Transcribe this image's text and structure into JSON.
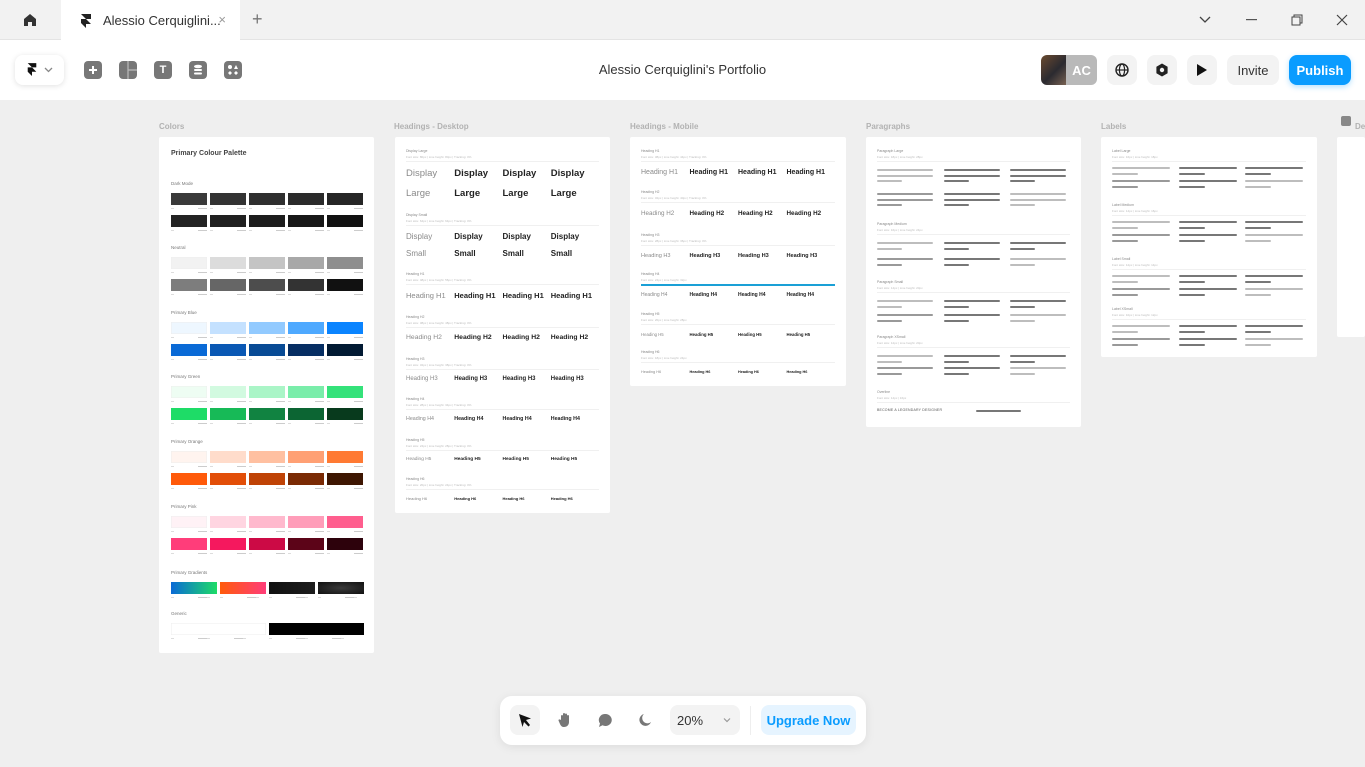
{
  "tabbar": {
    "tab_title": "Alessio Cerquiglini...",
    "close_glyph": "×",
    "new_tab_glyph": "+"
  },
  "toolbar": {
    "document_title": "Alessio Cerquiglini's Portfolio",
    "tools": [
      "insert-icon",
      "layout-icon",
      "text-icon",
      "cms-icon",
      "components-icon"
    ],
    "text_tool_glyph": "T",
    "avatar_initials": "AC",
    "invite_label": "Invite",
    "publish_label": "Publish"
  },
  "canvas": {
    "frames": [
      {
        "label": "Colors"
      },
      {
        "label": "Headings - Desktop"
      },
      {
        "label": "Headings - Mobile"
      },
      {
        "label": "Paragraphs"
      },
      {
        "label": "Labels"
      },
      {
        "label": "De"
      }
    ],
    "colors": {
      "title": "Primary Colour Palette",
      "groups": [
        {
          "name": "Dark Mode",
          "rows": [
            [
              "#3a3a3a",
              "#333333",
              "#2f2f2f",
              "#2b2b2b",
              "#262626"
            ],
            [
              "#232323",
              "#202020",
              "#1d1d1d",
              "#181818",
              "#111111"
            ]
          ]
        },
        {
          "name": "Neutral",
          "rows": [
            [
              "#f2f2f2",
              "#dcdcdc",
              "#c4c4c4",
              "#a8a8a8",
              "#8e8e8e"
            ],
            [
              "#7d7d7d",
              "#666666",
              "#4d4d4d",
              "#333333",
              "#111111"
            ]
          ]
        },
        {
          "name": "Primary Blue",
          "rows": [
            [
              "#eef7ff",
              "#c4e1ff",
              "#92caff",
              "#4ea9ff",
              "#0a84ff"
            ],
            [
              "#0a6ad6",
              "#0a58b4",
              "#084b95",
              "#062e63",
              "#021a33"
            ]
          ]
        },
        {
          "name": "Primary Green",
          "rows": [
            [
              "#eefdf3",
              "#d2fae0",
              "#aaf5c7",
              "#7aedaa",
              "#34e27a"
            ],
            [
              "#1edc67",
              "#17ba57",
              "#118341",
              "#0c6533",
              "#083a1d"
            ]
          ]
        },
        {
          "name": "Primary Orange",
          "rows": [
            [
              "#fff4ef",
              "#ffdccb",
              "#ffc0a1",
              "#ffa074",
              "#ff7a33"
            ],
            [
              "#ff5a0a",
              "#e24e08",
              "#bf4306",
              "#7a2a04",
              "#3e1602"
            ]
          ]
        },
        {
          "name": "Primary Pink",
          "rows": [
            [
              "#fff2f6",
              "#ffd5e1",
              "#ffb9cd",
              "#ff9db9",
              "#ff5e8e"
            ],
            [
              "#ff3d7a",
              "#f5185e",
              "#cc0a45",
              "#5c0418",
              "#2d020c"
            ]
          ]
        },
        {
          "name": "Primary Gradients",
          "gradients": [
            "linear-gradient(90deg,#0a6ad6,#1edc67)",
            "linear-gradient(90deg,#ff5a0a,#ff3d7a)",
            "linear-gradient(90deg,#111111,#1d1d1d)",
            "radial-gradient(#3a3a3a,#111111)"
          ]
        },
        {
          "name": "Generic",
          "rows": [
            [
              "#ffffff",
              "#000000"
            ]
          ]
        }
      ]
    },
    "headings_desktop": {
      "sections": [
        {
          "name": "Display Large",
          "spec": "Font size: 80px | Line height: 80px | Tracking: 0%",
          "lines": [
            "Display",
            "Large"
          ]
        },
        {
          "name": "Display Small",
          "spec": "Font size: 64px | Line height: 64px | Tracking: 0%",
          "lines": [
            "Display",
            "Small"
          ]
        },
        {
          "name": "Heading H1",
          "spec": "Font size: 48px | Line height: 56px | Tracking: 0%",
          "lines": [
            "Heading H1"
          ]
        },
        {
          "name": "Heading H2",
          "spec": "Font size: 38px | Line height: 48px | Tracking: 0%",
          "lines": [
            "Heading H2"
          ]
        },
        {
          "name": "Heading H3",
          "spec": "Font size: 32px | Line height: 38px | Tracking: 0%",
          "lines": [
            "Heading H3"
          ]
        },
        {
          "name": "Heading H4",
          "spec": "Font size: 28px | Line height: 34px | Tracking: 0%",
          "lines": [
            "Heading H4"
          ]
        },
        {
          "name": "Heading H5",
          "spec": "Font size: 24px | Line height: 28px | Tracking: 0%",
          "lines": [
            "Heading H5"
          ]
        },
        {
          "name": "Heading H6",
          "spec": "Font size: 20px | Line height: 24px | Tracking: 0%",
          "lines": [
            "Heading H6"
          ]
        }
      ]
    },
    "headings_mobile": {
      "sections": [
        {
          "name": "Heading H1",
          "spec": "Font size: 38px | Line height: 44px | Tracking: 0%",
          "text": "Heading H1"
        },
        {
          "name": "Heading H2",
          "spec": "Font size: 32px | Line height: 40px | Tracking: 0%",
          "text": "Heading H2"
        },
        {
          "name": "Heading H3",
          "spec": "Font size: 28px | Line height: 36px | Tracking: 0%",
          "text": "Heading H3"
        },
        {
          "name": "Heading H4",
          "spec": "Font size: 24px | Line height: 32px",
          "text": "Heading H4"
        },
        {
          "name": "Heading H5",
          "spec": "Font size: 20px | Line height: 28px",
          "text": "Heading H5"
        },
        {
          "name": "Heading H6",
          "spec": "Font size: 18px | Line height: 24px",
          "text": "Heading H6"
        }
      ]
    },
    "paragraphs": {
      "sections": [
        {
          "name": "Paragraph Large",
          "spec": "Font size: 18px | Line height: 28px"
        },
        {
          "name": "Paragraph Medium",
          "spec": "Font size: 16px | Line height: 24px"
        },
        {
          "name": "Paragraph Small",
          "spec": "Font size: 14px | Line height: 20px"
        },
        {
          "name": "Paragraph XSmall",
          "spec": "Font size: 12px | Line height: 20px"
        },
        {
          "name": "Overline",
          "spec": "Font size: 14px | 16px"
        }
      ],
      "sample": "Become a legendary UX/UI designer through real world and practical courses.",
      "overline_sample": "BECOME A LEGENDARY DESIGNER"
    },
    "labels": {
      "sections": [
        {
          "name": "Label Large",
          "spec": "Font size: 16px | Line height: 18px"
        },
        {
          "name": "Label Medium",
          "spec": "Font size: 14px | Line height: 16px"
        },
        {
          "name": "Label Small",
          "spec": "Font size: 12px | Line height: 14px"
        },
        {
          "name": "Label XSmall",
          "spec": "Font size: 10px | Line height: 12px"
        }
      ]
    }
  },
  "bottom_bar": {
    "zoom_level": "20%",
    "upgrade_label": "Upgrade Now"
  }
}
